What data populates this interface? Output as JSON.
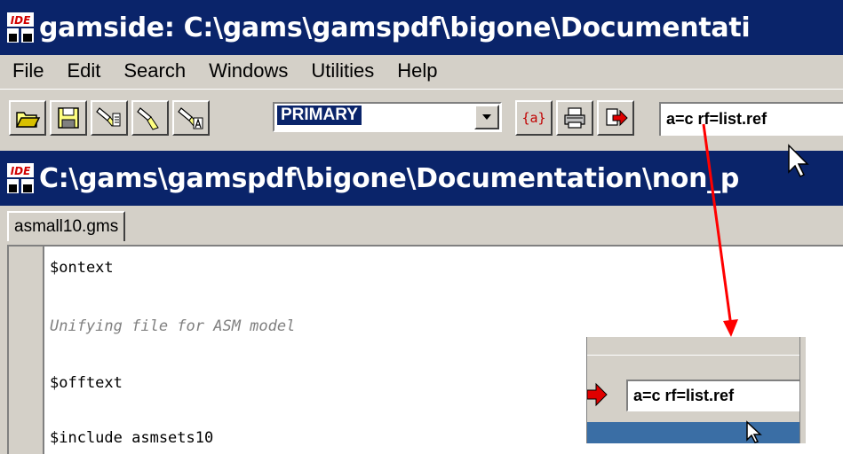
{
  "main_window": {
    "title": "gamside: C:\\gams\\gamspdf\\bigone\\Documentati",
    "logo_text": "IDE"
  },
  "menu": [
    "File",
    "Edit",
    "Search",
    "Windows",
    "Utilities",
    "Help"
  ],
  "toolbar": {
    "buttons": [
      "open-folder-icon",
      "save-disk-icon",
      "run-with-list-icon",
      "run-icon",
      "run-with-a-icon"
    ],
    "mode_select": "PRIMARY",
    "right_buttons": [
      "parameter-braces-icon",
      "print-icon",
      "options-arrow-icon"
    ],
    "parameters_value": "a=c rf=list.ref"
  },
  "child_window": {
    "title": "C:\\gams\\gamspdf\\bigone\\Documentation\\non_p"
  },
  "tab": {
    "label": "asmall10.gms"
  },
  "editor": {
    "lines": [
      {
        "text": "$ontext",
        "style": "code"
      },
      {
        "text": "Unifying file for ASM model",
        "style": "comment"
      },
      {
        "text": "$offtext",
        "style": "code"
      },
      {
        "text": "$include asmsets10",
        "style": "code"
      }
    ]
  },
  "zoom_inset": {
    "parameters_value": "a=c rf=list.ref"
  },
  "colors": {
    "titlebar": "#0a246a",
    "annotation_arrow": "#ff0000",
    "chrome": "#d4d0c8"
  }
}
